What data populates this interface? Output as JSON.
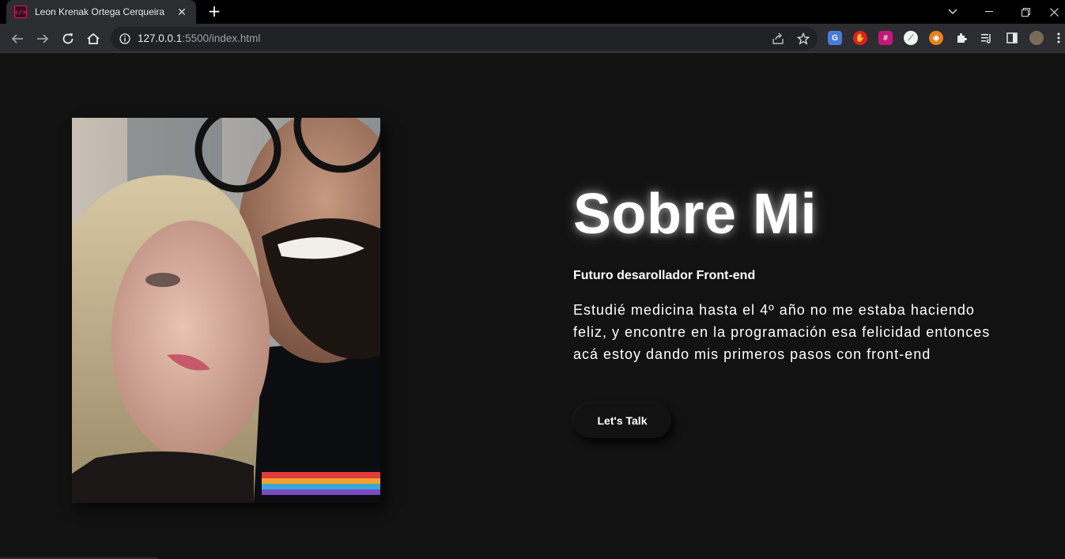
{
  "browser": {
    "tab_title": "Leon Krenak Ortega Cerqueira",
    "url_host": "127.0.0.1",
    "url_rest": ":5500/index.html"
  },
  "page": {
    "heading": "Sobre Mi",
    "subtitle": "Futuro desarollador Front-end",
    "bio": "Estudié medicina hasta el 4º año no me estaba haciendo feliz, y encontre en la programación esa felicidad entonces acá estoy dando mis primeros pasos con front-end",
    "cta_label": "Let's Talk"
  },
  "colors": {
    "background": "#121212",
    "text": "#ffffff",
    "chrome_bar": "#2b2d31"
  }
}
